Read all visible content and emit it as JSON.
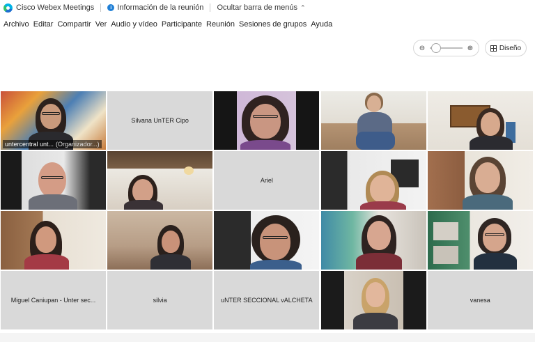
{
  "titlebar": {
    "app_name": "Cisco Webex Meetings",
    "meeting_info": "Información de la reunión",
    "hide_menu": "Ocultar barra de menús"
  },
  "menu": [
    "Archivo",
    "Editar",
    "Compartir",
    "Ver",
    "Audio y vídeo",
    "Participante",
    "Reunión",
    "Sesiones de grupos",
    "Ayuda"
  ],
  "view_controls": {
    "zoom_out_icon": "zoom-out-icon",
    "zoom_in_icon": "zoom-in-icon",
    "layout_label": "Diseño"
  },
  "participants": [
    {
      "name": "untercentral unt...",
      "role": "(Organizador...)",
      "video": true,
      "active": true
    },
    {
      "name": "Silvana UnTER Cipo",
      "video": false
    },
    {
      "name": "",
      "video": true
    },
    {
      "name": "",
      "video": true
    },
    {
      "name": "",
      "video": true
    },
    {
      "name": "",
      "video": true
    },
    {
      "name": "",
      "video": true
    },
    {
      "name": "Ariel",
      "video": false
    },
    {
      "name": "",
      "video": true
    },
    {
      "name": "",
      "video": true
    },
    {
      "name": "",
      "video": true
    },
    {
      "name": "",
      "video": true
    },
    {
      "name": "",
      "video": true
    },
    {
      "name": "",
      "video": true
    },
    {
      "name": "",
      "video": true
    },
    {
      "name": "Miguel Caniupan - Unter sec...",
      "video": false
    },
    {
      "name": "silvia",
      "video": false
    },
    {
      "name": "uNTER SECCIONAL vALCHETA",
      "video": false
    },
    {
      "name": "",
      "video": true
    },
    {
      "name": "vanesa",
      "video": false
    }
  ]
}
